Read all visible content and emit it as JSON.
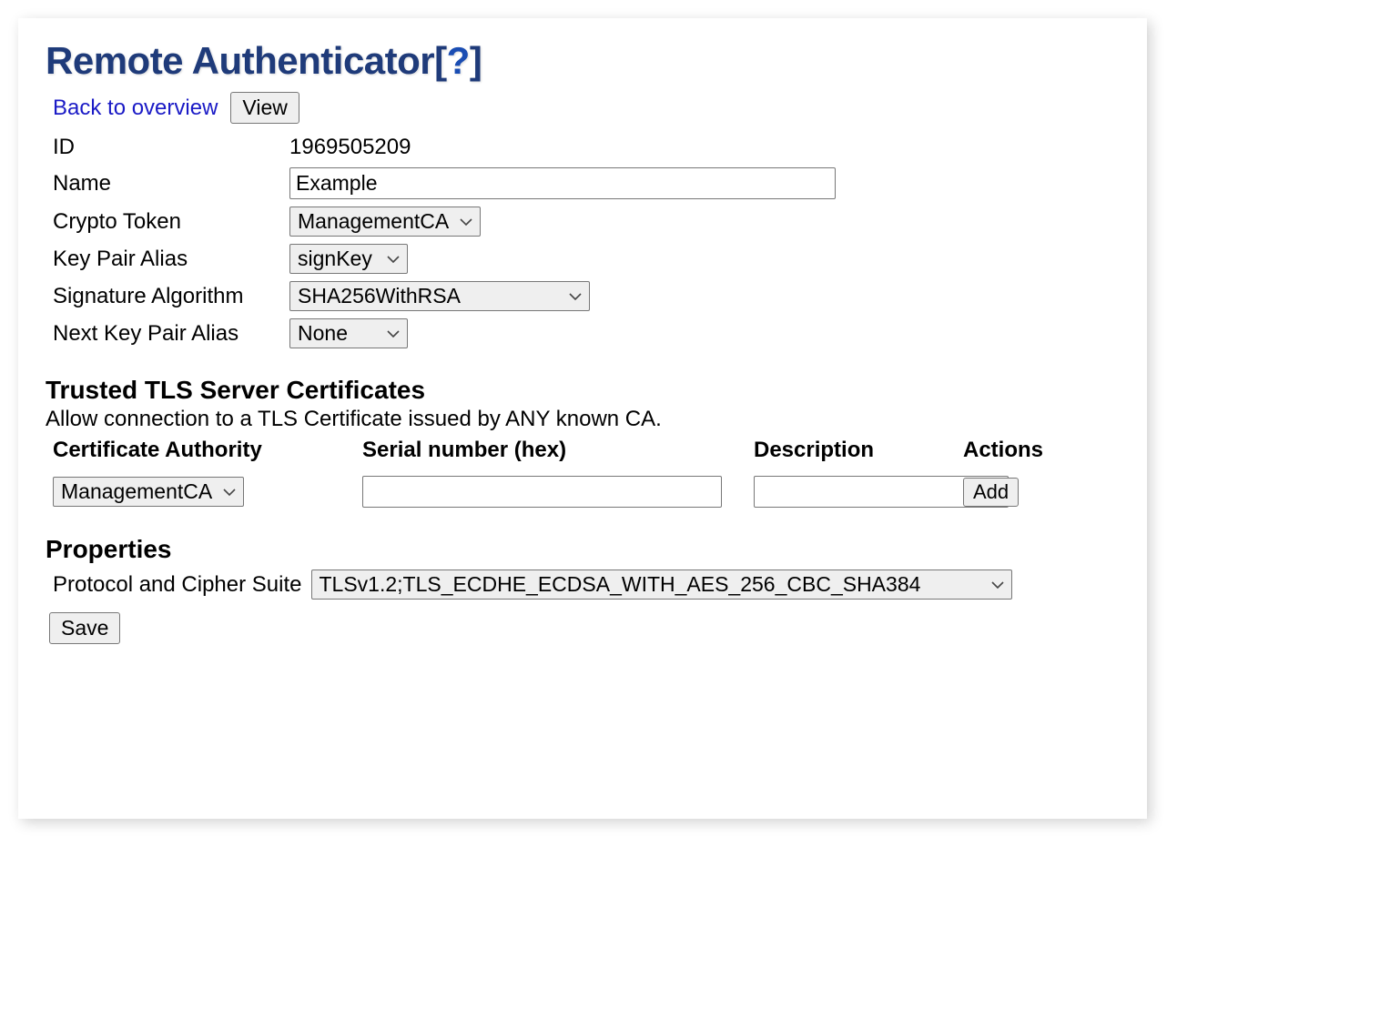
{
  "header": {
    "title": "Remote Authenticator",
    "help_open": "[",
    "help_qmark": "?",
    "help_close": "]"
  },
  "top": {
    "back_link": "Back to overview",
    "view_button": "View"
  },
  "form": {
    "id_label": "ID",
    "id_value": "1969505209",
    "name_label": "Name",
    "name_value": "Example",
    "crypto_token_label": "Crypto Token",
    "crypto_token_value": "ManagementCA",
    "key_pair_alias_label": "Key Pair Alias",
    "key_pair_alias_value": "signKey",
    "signature_alg_label": "Signature Algorithm",
    "signature_alg_value": "SHA256WithRSA",
    "next_key_pair_label": "Next Key Pair Alias",
    "next_key_pair_value": "None"
  },
  "tls": {
    "heading": "Trusted TLS Server Certificates",
    "subtext": "Allow connection to a TLS Certificate issued by ANY known CA.",
    "col_ca": "Certificate Authority",
    "col_serial": "Serial number (hex)",
    "col_desc": "Description",
    "col_actions": "Actions",
    "ca_select_value": "ManagementCA",
    "serial_value": "",
    "desc_value": "",
    "add_button": "Add"
  },
  "properties": {
    "heading": "Properties",
    "protocol_label": "Protocol and Cipher Suite",
    "protocol_value": "TLSv1.2;TLS_ECDHE_ECDSA_WITH_AES_256_CBC_SHA384"
  },
  "actions": {
    "save_button": "Save"
  }
}
